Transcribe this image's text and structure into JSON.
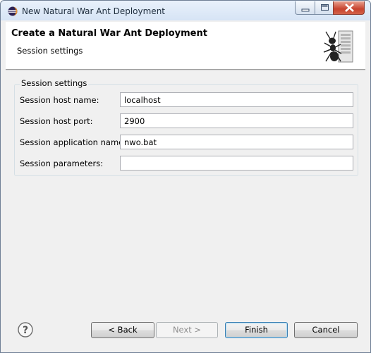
{
  "window": {
    "title": "New Natural War Ant Deployment",
    "icon": "eclipse-icon"
  },
  "header": {
    "title": "Create a Natural War Ant Deployment",
    "subtitle": "Session settings",
    "graphic": "ant-server-icon"
  },
  "group": {
    "legend": "Session settings",
    "fields": [
      {
        "label": "Session host name:",
        "value": "localhost"
      },
      {
        "label": "Session host port:",
        "value": "2900"
      },
      {
        "label": "Session application name:",
        "value": "nwo.bat"
      },
      {
        "label": "Session parameters:",
        "value": ""
      }
    ]
  },
  "buttons": {
    "help": "help-icon",
    "back": "< Back",
    "next": "Next >",
    "finish": "Finish",
    "cancel": "Cancel"
  },
  "colors": {
    "finish_border": "#3c7fb1",
    "close_button": "#c7432e"
  }
}
